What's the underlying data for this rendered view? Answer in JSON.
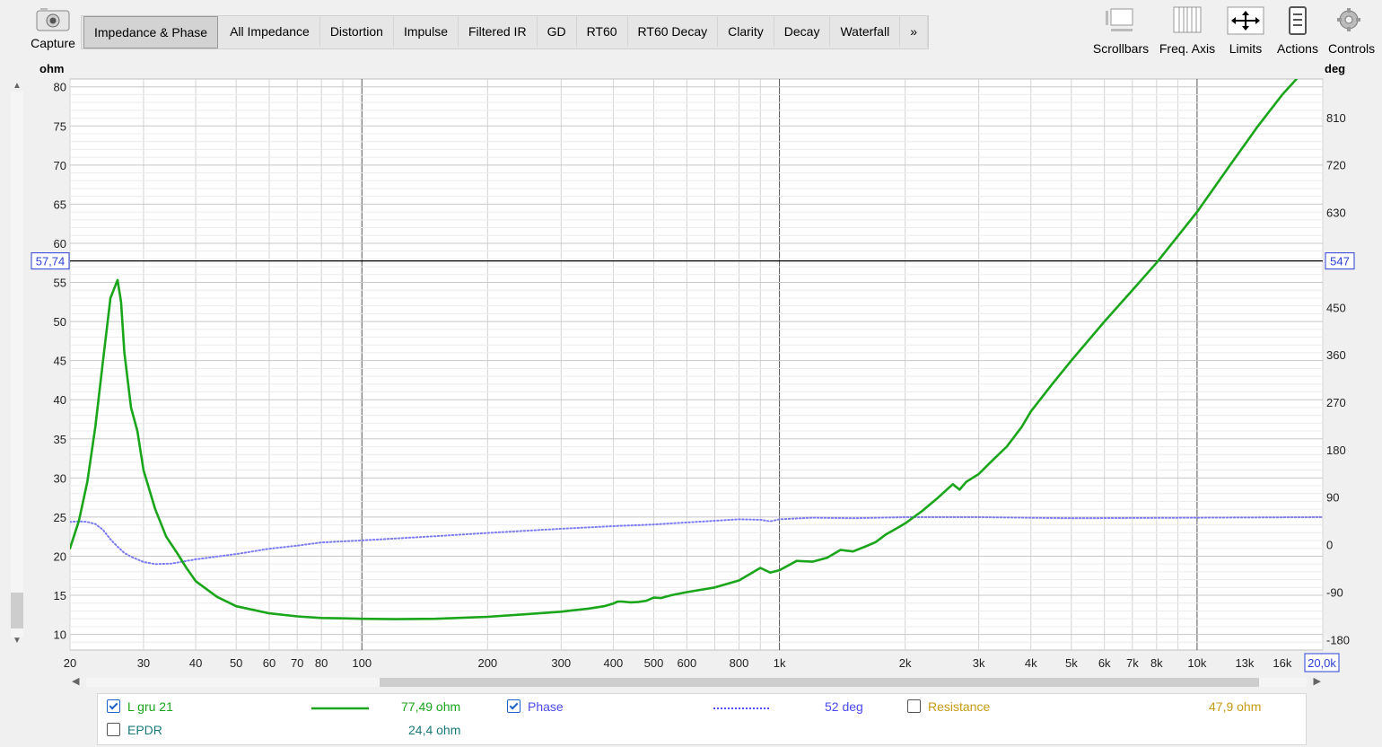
{
  "toolbar": {
    "capture_label": "Capture",
    "tabs": [
      "Impedance & Phase",
      "All Impedance",
      "Distortion",
      "Impulse",
      "Filtered IR",
      "GD",
      "RT60",
      "RT60 Decay",
      "Clarity",
      "Decay",
      "Waterfall",
      "»"
    ],
    "active_tab": "Impedance & Phase",
    "tools": [
      {
        "label": "Scrollbars",
        "icon": "scrollbars-icon"
      },
      {
        "label": "Freq. Axis",
        "icon": "freq-axis-icon"
      },
      {
        "label": "Limits",
        "icon": "limits-icon"
      },
      {
        "label": "Actions",
        "icon": "actions-icon"
      },
      {
        "label": "Controls",
        "icon": "gear-icon"
      }
    ]
  },
  "chart_data": {
    "type": "line",
    "y_left_unit": "ohm",
    "y_right_unit": "deg",
    "x_scale": "log",
    "xlim": [
      20,
      20000
    ],
    "ylim_left": [
      8,
      81
    ],
    "ylim_right": [
      -200,
      883
    ],
    "left_ticks": [
      "80",
      "75",
      "70",
      "65",
      "60",
      "55",
      "50",
      "45",
      "40",
      "35",
      "30",
      "25",
      "20",
      "15",
      "10"
    ],
    "right_ticks": [
      "810",
      "720",
      "630",
      "450",
      "360",
      "270",
      "180",
      "90",
      "0",
      "-90",
      "-180"
    ],
    "x_ticks": [
      {
        "v": 20,
        "label": "20"
      },
      {
        "v": 30,
        "label": "30"
      },
      {
        "v": 40,
        "label": "40"
      },
      {
        "v": 50,
        "label": "50"
      },
      {
        "v": 60,
        "label": "60"
      },
      {
        "v": 70,
        "label": "70"
      },
      {
        "v": 80,
        "label": "80"
      },
      {
        "v": 100,
        "label": "100"
      },
      {
        "v": 200,
        "label": "200"
      },
      {
        "v": 300,
        "label": "300"
      },
      {
        "v": 400,
        "label": "400"
      },
      {
        "v": 500,
        "label": "500"
      },
      {
        "v": 600,
        "label": "600"
      },
      {
        "v": 800,
        "label": "800"
      },
      {
        "v": 1000,
        "label": "1k"
      },
      {
        "v": 2000,
        "label": "2k"
      },
      {
        "v": 3000,
        "label": "3k"
      },
      {
        "v": 4000,
        "label": "4k"
      },
      {
        "v": 5000,
        "label": "5k"
      },
      {
        "v": 6000,
        "label": "6k"
      },
      {
        "v": 7000,
        "label": "7k"
      },
      {
        "v": 8000,
        "label": "8k"
      },
      {
        "v": 10000,
        "label": "10k"
      },
      {
        "v": 13000,
        "label": "13k"
      },
      {
        "v": 16000,
        "label": "16k"
      }
    ],
    "cursor": {
      "y_left_label": "57,74",
      "y_right_label": "547",
      "x_label": "20,0k",
      "value": 57.74
    },
    "grid": true,
    "series": [
      {
        "name": "L gru 21",
        "axis": "left",
        "color": "#1aa51a",
        "style": "solid",
        "x": [
          20,
          21,
          22,
          23,
          24,
          25,
          26,
          26.5,
          27,
          28,
          29,
          30,
          32,
          34,
          36,
          38,
          40,
          45,
          50,
          60,
          70,
          80,
          90,
          100,
          120,
          150,
          200,
          250,
          300,
          350,
          380,
          400,
          410,
          420,
          440,
          460,
          480,
          500,
          520,
          550,
          600,
          700,
          800,
          900,
          950,
          1000,
          1100,
          1200,
          1300,
          1400,
          1500,
          1600,
          1700,
          1800,
          1900,
          2000,
          2200,
          2400,
          2600,
          2700,
          2800,
          3000,
          3200,
          3500,
          3800,
          4000,
          4500,
          5000,
          6000,
          7000,
          8000,
          10000,
          12000,
          14000,
          16000,
          18000,
          20000
        ],
        "values": [
          21.0,
          24.5,
          29.5,
          36.5,
          45.0,
          53.0,
          55.3,
          52.5,
          46.0,
          39.0,
          36.0,
          31.0,
          26.0,
          22.5,
          20.5,
          18.5,
          16.8,
          14.8,
          13.6,
          12.7,
          12.3,
          12.1,
          12.05,
          12.0,
          11.95,
          12.0,
          12.25,
          12.6,
          12.9,
          13.3,
          13.6,
          13.95,
          14.2,
          14.2,
          14.1,
          14.15,
          14.3,
          14.7,
          14.65,
          15.0,
          15.4,
          16.0,
          16.9,
          18.5,
          17.9,
          18.2,
          19.4,
          19.3,
          19.8,
          20.8,
          20.6,
          21.2,
          21.8,
          22.8,
          23.5,
          24.2,
          25.8,
          27.5,
          29.2,
          28.5,
          29.5,
          30.5,
          32.0,
          34.0,
          36.5,
          38.5,
          42.0,
          45.0,
          50.0,
          54.0,
          57.5,
          64.0,
          70.0,
          75.0,
          79.0,
          82.0,
          86.0
        ]
      },
      {
        "name": "Phase",
        "axis": "right",
        "color": "#7b7bf5",
        "style": "dotted",
        "x": [
          20,
          21,
          22,
          23,
          24,
          25,
          26,
          27,
          28,
          29,
          30,
          32,
          35,
          40,
          50,
          60,
          70,
          80,
          100,
          150,
          200,
          300,
          400,
          500,
          600,
          800,
          900,
          950,
          1000,
          1200,
          1500,
          2000,
          3000,
          5000,
          10000,
          20000
        ],
        "values": [
          43,
          44,
          43,
          39,
          28,
          10,
          -4,
          -16,
          -23,
          -28,
          -33,
          -37,
          -36,
          -28,
          -18,
          -8,
          -2,
          4,
          8,
          16,
          22,
          30,
          35,
          38,
          42,
          48,
          47,
          44,
          48,
          51,
          50,
          52,
          52,
          50,
          51,
          52
        ]
      }
    ]
  },
  "legend": {
    "items": [
      {
        "label": "L gru 21",
        "checked": true,
        "value": "77,49 ohm",
        "color": "#1aa51a"
      },
      {
        "label": "Phase",
        "checked": true,
        "value": "52 deg",
        "color": "#4a4af0"
      },
      {
        "label": "Resistance",
        "checked": false,
        "value": "47,9 ohm",
        "color": "#c69a14"
      },
      {
        "label": "EPDR",
        "checked": false,
        "value": "24,4 ohm",
        "color": "#1a7a7a"
      }
    ]
  }
}
